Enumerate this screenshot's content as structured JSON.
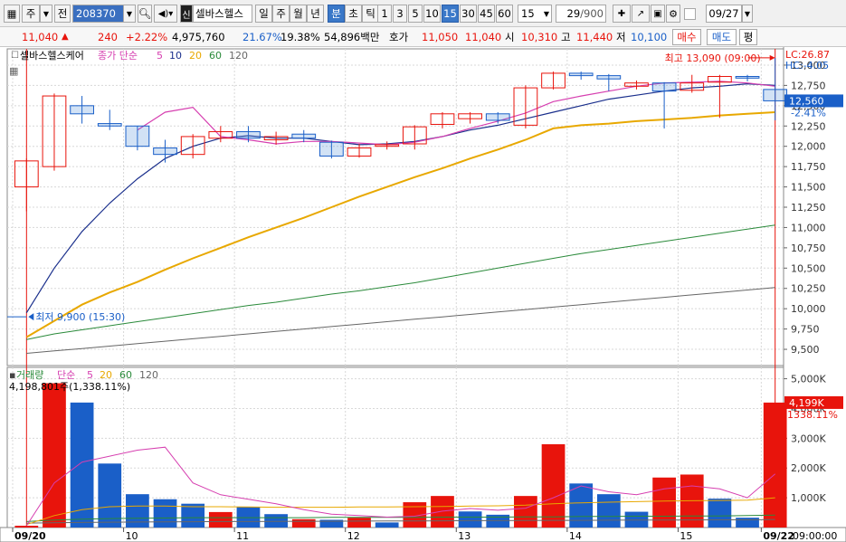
{
  "toolbar": {
    "type_label": "주",
    "prev_label": "전",
    "code": "208370",
    "stock_badge": "신",
    "stock_name": "셀바스헬스",
    "periods": [
      "일",
      "주",
      "월",
      "년",
      "분",
      "초",
      "틱"
    ],
    "active_period": "분",
    "intervals": [
      "1",
      "3",
      "5",
      "10",
      "15",
      "30",
      "45",
      "60"
    ],
    "active_interval": "15",
    "interval_select": "15",
    "count": "29",
    "count_total": "/900",
    "date": "09/27"
  },
  "quote": {
    "price": "11,040",
    "change_arrow": "▲",
    "change": "240",
    "change_pct": "+2.22%",
    "volume": "4,975,760",
    "ratio1": "21.67%",
    "ratio2": "19.38%",
    "amount": "54,896백만",
    "ask_label": "호가",
    "ask": "11,050",
    "bid": "11,040",
    "open_label": "시",
    "open": "10,310",
    "high_label": "고",
    "high": "11,440",
    "low_label": "저",
    "low": "10,100",
    "buy_label": "매수",
    "sell_label": "매도",
    "avg_label": "평"
  },
  "colors": {
    "up": "#e8140c",
    "down": "#1a5fc8",
    "ma5": "#d63fb0",
    "ma10": "#1a2f8c",
    "ma20": "#e8a800",
    "ma60": "#2a8a3a",
    "ma120": "#666666"
  },
  "chart_data": [
    {
      "type": "candlestick",
      "title": "셀바스헬스케어",
      "legend": {
        "name": "종가 단순",
        "periods": [
          "5",
          "10",
          "20",
          "60",
          "120"
        ]
      },
      "ylim": [
        9300,
        13200
      ],
      "yticks": [
        9500,
        9750,
        10000,
        10250,
        10500,
        10750,
        11000,
        11250,
        11500,
        11750,
        12000,
        12250,
        12500,
        12750,
        13000
      ],
      "ytick_labels": [
        "9,500",
        "9,750",
        "10,000",
        "10,250",
        "10,500",
        "10,750",
        "11,000",
        "11,250",
        "11,500",
        "11,750",
        "12,000",
        "12,250",
        "12,500",
        "12,750",
        "13,000"
      ],
      "x_labels": [
        {
          "index": 0,
          "text": "09/20"
        },
        {
          "index": 4,
          "text": "10"
        },
        {
          "index": 8,
          "text": "11"
        },
        {
          "index": 12,
          "text": "12"
        },
        {
          "index": 16,
          "text": "13"
        },
        {
          "index": 20,
          "text": "14"
        },
        {
          "index": 24,
          "text": "15"
        },
        {
          "index": 27,
          "text": "09/22"
        }
      ],
      "candles": [
        {
          "o": 11500,
          "h": 11850,
          "l": 11200,
          "c": 11820
        },
        {
          "o": 11750,
          "h": 12650,
          "l": 11700,
          "c": 12620
        },
        {
          "o": 12500,
          "h": 12620,
          "l": 12280,
          "c": 12400
        },
        {
          "o": 12280,
          "h": 12450,
          "l": 12200,
          "c": 12250
        },
        {
          "o": 12250,
          "h": 12250,
          "l": 11950,
          "c": 12000
        },
        {
          "o": 11980,
          "h": 12080,
          "l": 11800,
          "c": 11900
        },
        {
          "o": 11900,
          "h": 12150,
          "l": 11850,
          "c": 12120
        },
        {
          "o": 12100,
          "h": 12250,
          "l": 12050,
          "c": 12180
        },
        {
          "o": 12180,
          "h": 12250,
          "l": 12050,
          "c": 12100
        },
        {
          "o": 12080,
          "h": 12180,
          "l": 12020,
          "c": 12120
        },
        {
          "o": 12150,
          "h": 12200,
          "l": 12050,
          "c": 12100
        },
        {
          "o": 12050,
          "h": 12070,
          "l": 11850,
          "c": 11880
        },
        {
          "o": 11880,
          "h": 12030,
          "l": 11860,
          "c": 11980
        },
        {
          "o": 12000,
          "h": 12060,
          "l": 11960,
          "c": 12020
        },
        {
          "o": 12030,
          "h": 12260,
          "l": 11960,
          "c": 12240
        },
        {
          "o": 12270,
          "h": 12420,
          "l": 12220,
          "c": 12400
        },
        {
          "o": 12340,
          "h": 12420,
          "l": 12280,
          "c": 12400
        },
        {
          "o": 12400,
          "h": 12420,
          "l": 12280,
          "c": 12320
        },
        {
          "o": 12260,
          "h": 12750,
          "l": 12220,
          "c": 12720
        },
        {
          "o": 12720,
          "h": 12920,
          "l": 12700,
          "c": 12900
        },
        {
          "o": 12900,
          "h": 12920,
          "l": 12820,
          "c": 12870
        },
        {
          "o": 12870,
          "h": 12890,
          "l": 12680,
          "c": 12830
        },
        {
          "o": 12740,
          "h": 12810,
          "l": 12700,
          "c": 12780
        },
        {
          "o": 12780,
          "h": 12790,
          "l": 12220,
          "c": 12680
        },
        {
          "o": 12690,
          "h": 12880,
          "l": 12660,
          "c": 12780
        },
        {
          "o": 12790,
          "h": 12880,
          "l": 12350,
          "c": 12860
        },
        {
          "o": 12860,
          "h": 12880,
          "l": 12800,
          "c": 12840
        },
        {
          "o": 12700,
          "h": 13090,
          "l": 12320,
          "c": 12560
        }
      ],
      "ma5": [
        null,
        null,
        null,
        null,
        12200,
        12420,
        12480,
        12120,
        12080,
        12030,
        12060,
        12060,
        12040,
        12020,
        12050,
        12120,
        12220,
        12310,
        12410,
        12550,
        12620,
        12680,
        12740,
        12780,
        12790,
        12800,
        12780,
        12740
      ],
      "ma10": [
        9950,
        10500,
        10950,
        11300,
        11600,
        11850,
        12000,
        12100,
        12130,
        12100,
        12100,
        12060,
        12020,
        12030,
        12060,
        12120,
        12200,
        12260,
        12340,
        12420,
        12500,
        12580,
        12630,
        12680,
        12720,
        12740,
        12770,
        12750
      ],
      "ma20": [
        9650,
        9850,
        10050,
        10200,
        10330,
        10480,
        10620,
        10750,
        10880,
        11000,
        11120,
        11250,
        11380,
        11500,
        11620,
        11730,
        11850,
        11960,
        12080,
        12220,
        12260,
        12280,
        12310,
        12330,
        12350,
        12380,
        12400,
        12420
      ],
      "ma60": [
        9620,
        9690,
        9740,
        9790,
        9840,
        9890,
        9940,
        9990,
        10040,
        10080,
        10130,
        10180,
        10220,
        10270,
        10320,
        10380,
        10440,
        10500,
        10560,
        10620,
        10680,
        10730,
        10780,
        10830,
        10880,
        10930,
        10980,
        11030
      ],
      "ma120": [
        9450,
        9480,
        9510,
        9540,
        9570,
        9600,
        9630,
        9660,
        9690,
        9720,
        9750,
        9780,
        9810,
        9840,
        9870,
        9900,
        9930,
        9960,
        9990,
        10020,
        10050,
        10080,
        10110,
        10140,
        10170,
        10200,
        10230,
        10260
      ],
      "annotations": {
        "high_label": "최고 13,090 (09:00)",
        "high_value": 13090,
        "high_index": 27,
        "low_label": "최저 9,900 (15:30)",
        "low_value": 9900,
        "current_label": "12,560",
        "current_pct": "-2.41%",
        "lc_label": "LC:26.87",
        "hc_label": "HC:-4.05"
      }
    },
    {
      "type": "bar",
      "title": "거래량",
      "legend": {
        "name": "단순",
        "periods": [
          "5",
          "20",
          "60",
          "120"
        ]
      },
      "ylim": [
        0,
        5200000
      ],
      "yticks": [
        1000000,
        2000000,
        3000000,
        4000000,
        5000000
      ],
      "ytick_labels": [
        "1,000K",
        "2,000K",
        "3,000K",
        "4,000K",
        "5,000K"
      ],
      "current_label": "4,199K",
      "current_pct": "1338.11%",
      "info": "4,198,801주(1,338.11%)",
      "values": [
        60000,
        4850000,
        4200000,
        2150000,
        1120000,
        950000,
        800000,
        520000,
        700000,
        450000,
        280000,
        260000,
        330000,
        170000,
        850000,
        1060000,
        540000,
        430000,
        1060000,
        2800000,
        1480000,
        1120000,
        530000,
        1680000,
        1780000,
        970000,
        330000,
        4199000
      ],
      "up": [
        true,
        true,
        false,
        false,
        false,
        false,
        false,
        true,
        false,
        false,
        true,
        false,
        true,
        false,
        true,
        true,
        false,
        false,
        true,
        true,
        false,
        false,
        false,
        true,
        true,
        false,
        false,
        true
      ],
      "ma5": [
        60000,
        1500000,
        2200000,
        2400000,
        2600000,
        2700000,
        1500000,
        1100000,
        950000,
        800000,
        600000,
        450000,
        400000,
        350000,
        380000,
        550000,
        640000,
        580000,
        650000,
        1000000,
        1400000,
        1200000,
        1100000,
        1300000,
        1400000,
        1300000,
        1000000,
        1800000
      ],
      "ma20": [
        100000,
        400000,
        600000,
        700000,
        720000,
        720000,
        700000,
        700000,
        690000,
        680000,
        680000,
        680000,
        690000,
        690000,
        700000,
        710000,
        720000,
        730000,
        750000,
        800000,
        830000,
        850000,
        870000,
        890000,
        900000,
        910000,
        920000,
        1000000
      ],
      "ma60": [
        200000,
        250000,
        280000,
        300000,
        310000,
        320000,
        330000,
        330000,
        330000,
        330000,
        330000,
        340000,
        340000,
        340000,
        340000,
        350000,
        350000,
        350000,
        360000,
        360000,
        370000,
        370000,
        380000,
        380000,
        390000,
        390000,
        400000,
        420000
      ],
      "ma120": [
        150000,
        160000,
        170000,
        180000,
        185000,
        190000,
        195000,
        200000,
        200000,
        205000,
        210000,
        210000,
        215000,
        220000,
        220000,
        225000,
        230000,
        230000,
        235000,
        240000,
        240000,
        245000,
        250000,
        250000,
        255000,
        260000,
        260000,
        270000
      ]
    }
  ],
  "right_footer": "09:00:00"
}
